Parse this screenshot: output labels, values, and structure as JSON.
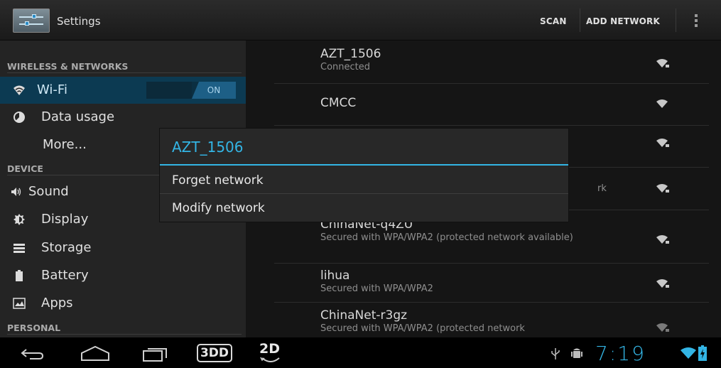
{
  "actionbar": {
    "title": "Settings",
    "scan_label": "SCAN",
    "add_network_label": "ADD NETWORK",
    "icon": "settings-sliders-icon",
    "overflow_icon": "overflow-menu-icon"
  },
  "sidebar": {
    "section_wireless": "WIRELESS & NETWORKS",
    "section_device": "DEVICE",
    "section_personal": "PERSONAL",
    "items": [
      {
        "label": "Wi-Fi",
        "icon": "wifi-icon",
        "selected": true
      },
      {
        "label": "Data usage",
        "icon": "data-usage-icon"
      },
      {
        "label": "More...",
        "icon": ""
      },
      {
        "label": "Sound",
        "icon": "speaker-icon"
      },
      {
        "label": "Display",
        "icon": "brightness-icon"
      },
      {
        "label": "Storage",
        "icon": "storage-icon"
      },
      {
        "label": "Battery",
        "icon": "battery-icon"
      },
      {
        "label": "Apps",
        "icon": "apps-icon"
      }
    ],
    "wifi_toggle_label": "ON"
  },
  "networks": [
    {
      "name": "AZT_1506",
      "status": "Connected"
    },
    {
      "name": "CMCC",
      "status": ""
    },
    {
      "name": "",
      "status": ""
    },
    {
      "name": "",
      "status": "rk"
    },
    {
      "name": "ChinaNet-q4ZU",
      "status": "Secured with WPA/WPA2 (protected network available)"
    },
    {
      "name": "lihua",
      "status": "Secured with WPA/WPA2"
    },
    {
      "name": "ChinaNet-r3gz",
      "status": "Secured with WPA/WPA2 (protected network"
    }
  ],
  "dialog": {
    "title": "AZT_1506",
    "items": [
      "Forget network",
      "Modify network"
    ]
  },
  "navbar": {
    "back_icon": "back-icon",
    "home_icon": "home-icon",
    "recents_icon": "recent-apps-icon",
    "btn_3d_label": "3DD",
    "btn_2d_label": "2D",
    "clock": "7:19"
  },
  "colors": {
    "accent": "#33b5e5",
    "selected_bg": "#0c3a52"
  }
}
